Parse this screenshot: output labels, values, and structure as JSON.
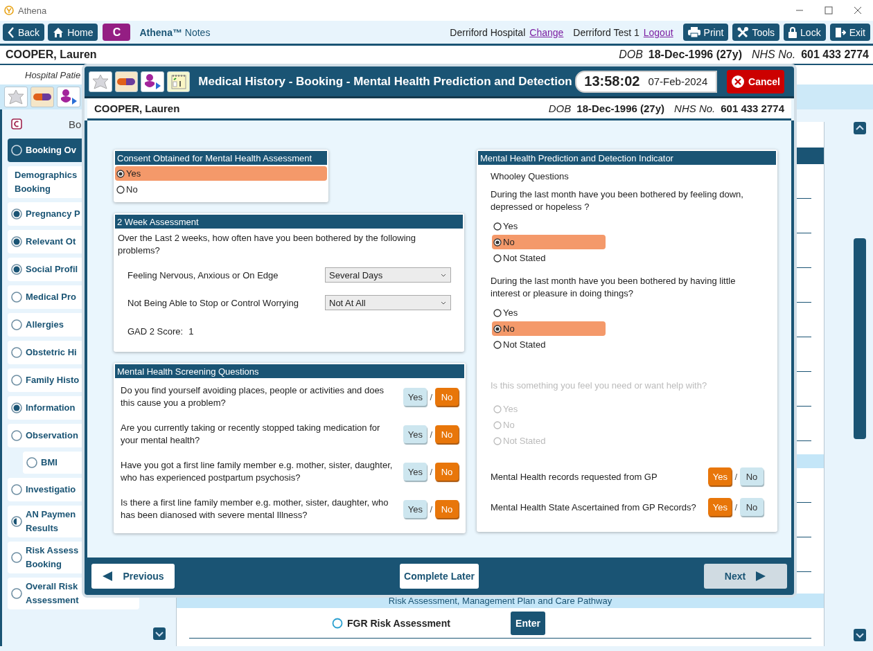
{
  "window": {
    "title": "Athena"
  },
  "toolbar": {
    "left_buttons": [
      {
        "label": "Back"
      },
      {
        "label": "Home"
      }
    ],
    "c_button": "C",
    "brand": "**Athena™** Notes",
    "location": "Derriford Hospital",
    "change_link": "Change",
    "user": "Derriford Test 1",
    "logout_link": "Logout",
    "right_buttons": [
      {
        "label": "Print"
      },
      {
        "label": "Tools"
      },
      {
        "label": "Lock"
      },
      {
        "label": "Exit"
      }
    ]
  },
  "patient_banner": {
    "name": "COOPER, Lauren",
    "dob_label": "DOB",
    "dob": "18-Dec-1996 (27y)",
    "nhs_label": "NHS No.",
    "nhs": "601 433 2774"
  },
  "sub_banner": "Hospital Patie",
  "sidebar": {
    "heading": "Bo",
    "items": [
      {
        "label": "Booking Ov",
        "kind": "radio",
        "complete": false,
        "partial": false,
        "selected": true
      },
      {
        "label": "Demographics Booking",
        "kind": "plain",
        "selected": false
      },
      {
        "label": "Pregnancy P",
        "kind": "radio",
        "complete": true,
        "partial": false,
        "selected": false
      },
      {
        "label": "Relevant Ot",
        "kind": "radio",
        "complete": true,
        "partial": false,
        "selected": false
      },
      {
        "label": "Social Profil",
        "kind": "radio",
        "complete": true,
        "partial": false,
        "selected": false
      },
      {
        "label": "Medical Pro",
        "kind": "radio",
        "complete": false,
        "partial": false,
        "selected": false
      },
      {
        "label": "Allergies",
        "kind": "radio",
        "complete": false,
        "partial": false,
        "selected": false
      },
      {
        "label": "Obstetric Hi",
        "kind": "radio",
        "complete": false,
        "partial": false,
        "selected": false
      },
      {
        "label": "Family Histo",
        "kind": "radio",
        "complete": false,
        "partial": false,
        "selected": false
      },
      {
        "label": "Information",
        "kind": "radio",
        "complete": true,
        "partial": false,
        "selected": false
      },
      {
        "label": "Observation",
        "kind": "radio",
        "complete": false,
        "partial": false,
        "selected": false,
        "children": [
          {
            "label": "BMI",
            "kind": "radio",
            "complete": false,
            "partial": false,
            "selected": false
          }
        ]
      },
      {
        "label": "Investigatio",
        "kind": "radio",
        "complete": false,
        "partial": false,
        "selected": false
      },
      {
        "label": "AN Paymen Results",
        "kind": "radio",
        "complete": false,
        "partial": true,
        "selected": false
      },
      {
        "label": "Risk Assess Booking",
        "kind": "radio",
        "complete": false,
        "partial": false,
        "selected": false
      },
      {
        "label": "Overall Risk Assessment",
        "kind": "radio",
        "complete": false,
        "partial": false,
        "selected": false
      }
    ]
  },
  "content": {
    "section_header": "Risk Assessment, Management Plan and Care Pathway",
    "rows": [
      {
        "label": "FGR Risk Assessment",
        "button": "Enter"
      }
    ]
  },
  "modal": {
    "title": "Medical History - Booking - Mental Health Prediction and Detection",
    "time": "13:58:02",
    "date": "07-Feb-2024",
    "cancel": "Cancel",
    "patient": {
      "name": "COOPER, Lauren",
      "dob_label": "DOB",
      "dob": "18-Dec-1996 (27y)",
      "nhs_label": "NHS No.",
      "nhs": "601 433 2774"
    },
    "consent": {
      "title": "Consent Obtained for Mental Health Assessment",
      "options": [
        {
          "label": "Yes",
          "selected": true
        },
        {
          "label": "No",
          "selected": false
        }
      ]
    },
    "assessment": {
      "title": "2 Week Assessment",
      "intro": "Over the Last 2 weeks, how often have you been bothered by the following problems?",
      "rows": [
        {
          "label": "Feeling Nervous, Anxious or On Edge",
          "value": "Several Days"
        },
        {
          "label": "Not Being Able to Stop or Control Worrying",
          "value": "Not At All"
        }
      ],
      "score_label": "GAD 2 Score:",
      "score": "1"
    },
    "screening": {
      "title": "Mental Health Screening Questions",
      "questions": [
        {
          "text": "Do you find yourself avoiding places, people or activities and does this cause you a problem?",
          "separator": "/",
          "options": [
            {
              "label": "Yes",
              "selected": false
            },
            {
              "label": "No",
              "selected": true
            }
          ]
        },
        {
          "text": "Are you currently taking or recently stopped taking medication for your mental health?",
          "separator": "/",
          "options": [
            {
              "label": "Yes",
              "selected": false
            },
            {
              "label": "No",
              "selected": true
            }
          ]
        },
        {
          "text": "Have you got a first line family member e.g. mother, sister, daughter, who has experienced postpartum psychosis?",
          "separator": "/",
          "options": [
            {
              "label": "Yes",
              "selected": false
            },
            {
              "label": "No",
              "selected": true
            }
          ]
        },
        {
          "text": "Is there a first line family member e.g. mother, sister, daughter, who has been dianosed with severe mental Illness?",
          "separator": "/",
          "options": [
            {
              "label": "Yes",
              "selected": false
            },
            {
              "label": "No",
              "selected": true
            }
          ]
        }
      ]
    },
    "indicator": {
      "title": "Mental Health Prediction and Detection Indicator",
      "subtitle": "Whooley Questions",
      "questions": [
        {
          "text": "During the last month have you been bothered by feeling down, depressed or hopeless ?",
          "disabled": false,
          "options": [
            {
              "label": "Yes",
              "selected": false
            },
            {
              "label": "No",
              "selected": true
            },
            {
              "label": "Not Stated",
              "selected": false
            }
          ]
        },
        {
          "text": "During the last month have you been bothered by having little interest or pleasure in doing things?",
          "disabled": false,
          "options": [
            {
              "label": "Yes",
              "selected": false
            },
            {
              "label": "No",
              "selected": true
            },
            {
              "label": "Not Stated",
              "selected": false
            }
          ]
        },
        {
          "text": "Is this something you feel you need or want help with?",
          "disabled": true,
          "options": [
            {
              "label": "Yes",
              "selected": false
            },
            {
              "label": "No",
              "selected": false
            },
            {
              "label": "Not Stated",
              "selected": false
            }
          ]
        }
      ],
      "gp_questions": [
        {
          "text": "Mental Health records requested from GP",
          "separator": "/",
          "options": [
            {
              "label": "Yes",
              "selected": true
            },
            {
              "label": "No",
              "selected": false
            }
          ]
        },
        {
          "text": "Mental Health State Ascertained from GP Records?",
          "separator": "/",
          "options": [
            {
              "label": "Yes",
              "selected": true
            },
            {
              "label": "No",
              "selected": false
            }
          ]
        }
      ]
    },
    "footer": {
      "previous": "Previous",
      "complete_later": "Complete Later",
      "next": {
        "label": "Next",
        "disabled": true
      }
    }
  }
}
